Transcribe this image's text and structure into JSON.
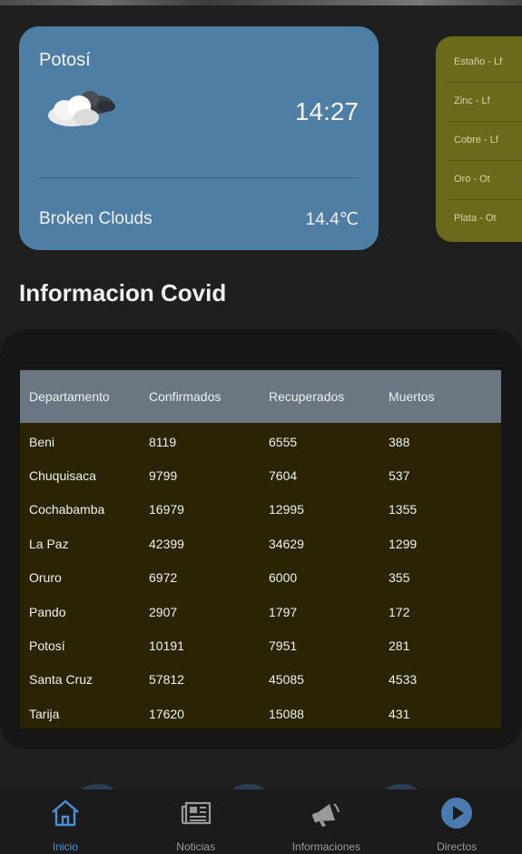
{
  "weather": {
    "city": "Potosí",
    "time": "14:27",
    "description": "Broken Clouds",
    "temperature": "14.4℃",
    "icon": "broken-clouds-icon"
  },
  "minerals": [
    "Estaño - Lf",
    "Zinc - Lf",
    "Cobre - Lf",
    "Oro - Ot",
    "Plata - Ot"
  ],
  "covid": {
    "title": "Informacion Covid",
    "columns": [
      "Departamento",
      "Confirmados",
      "Recuperados",
      "Muertos"
    ],
    "rows": [
      [
        "Beni",
        "8119",
        "6555",
        "388"
      ],
      [
        "Chuquisaca",
        "9799",
        "7604",
        "537"
      ],
      [
        "Cochabamba",
        "16979",
        "12995",
        "1355"
      ],
      [
        "La Paz",
        "42399",
        "34629",
        "1299"
      ],
      [
        "Oruro",
        "6972",
        "6000",
        "355"
      ],
      [
        "Pando",
        "2907",
        "1797",
        "172"
      ],
      [
        "Potosí",
        "10191",
        "7951",
        "281"
      ],
      [
        "Santa Cruz",
        "57812",
        "45085",
        "4533"
      ],
      [
        "Tarija",
        "17620",
        "15088",
        "431"
      ]
    ]
  },
  "nav": {
    "items": [
      {
        "label": "Inicio",
        "icon": "home-icon",
        "active": true
      },
      {
        "label": "Noticias",
        "icon": "newspaper-icon",
        "active": false
      },
      {
        "label": "Informaciones",
        "icon": "megaphone-icon",
        "active": false
      },
      {
        "label": "Directos",
        "icon": "play-icon",
        "active": false
      }
    ]
  },
  "colors": {
    "weather_card": "#4f7ea5",
    "minerals_card": "#6b6a1a",
    "table_header": "#6a7681",
    "table_body": "#2a2405",
    "nav_active": "#4a90d9"
  }
}
